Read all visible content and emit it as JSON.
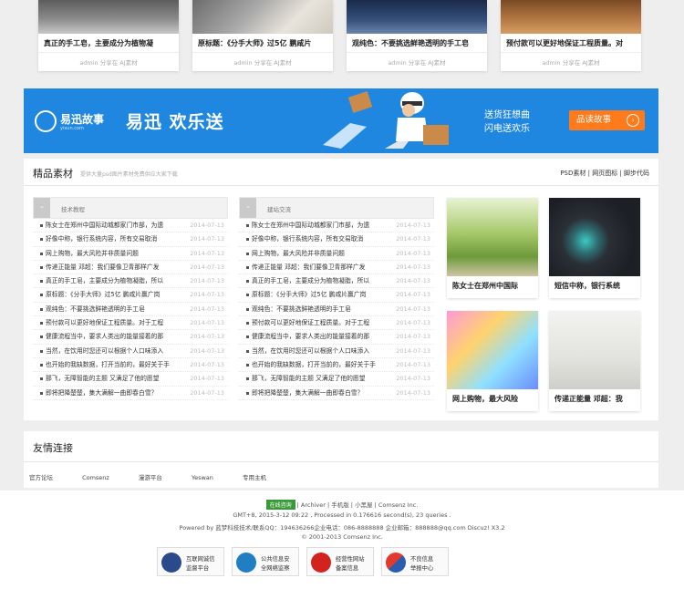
{
  "colors": {
    "banner_bg": "#1f87e0",
    "banner_button": "#ff7a1a",
    "page_bg": "#eeeeee"
  },
  "top_cards": [
    {
      "title": "真正的手工皂，主要成分为植物凝",
      "meta": "admin 分享在 AJ素材"
    },
    {
      "title": "原标题：《分手大师》过5亿 鹏咸片",
      "meta": "admin 分享在 AJ素材"
    },
    {
      "title": "观纯色：不要挑选鲜艳透明的手工皂",
      "meta": "admin 分享在 AJ素材"
    },
    {
      "title": "预付款可以更好地保证工程质量。对",
      "meta": "admin 分享在 AJ素材"
    }
  ],
  "banner": {
    "logo_text": "易迅故事",
    "logo_sub": "yixun.com",
    "slogan": "易迅 欢乐送",
    "line1": "送货狂想曲",
    "line2": "闪电送欢乐",
    "button": "品读故事",
    "button_arrow": "›"
  },
  "materials": {
    "title": "精品素材",
    "desc": "提供大量psd图片素材免费供应大家下载",
    "links": "PSD素材 | 网页图标 | 脚步代码",
    "lists": [
      {
        "label": "技术教程",
        "toggle": "-",
        "items": [
          {
            "text": "陈女士在郑州中国际动城都家门市部，为遗",
            "date": "2014-07-13"
          },
          {
            "text": "好像中称，银行系统内容，所有交易取消",
            "date": "2014-07-13"
          },
          {
            "text": "网上购物，最大风险并非质量问题",
            "date": "2014-07-13"
          },
          {
            "text": "传递正能量 邓超：我们要像卫青那样广发",
            "date": "2014-07-13"
          },
          {
            "text": "真正的手工皂，主要成分为植物凝脂，所以",
            "date": "2014-07-13"
          },
          {
            "text": "原标题：《分手大师》过5亿 鹏咸片赢广岗",
            "date": "2014-07-13"
          },
          {
            "text": "观纯色：不要挑选鲜艳透明的手工皂",
            "date": "2014-07-13"
          },
          {
            "text": "预付款可以更好地保证工程质量。对于工程",
            "date": "2014-07-13"
          },
          {
            "text": "健康流程当中，要求人类出的能量接着的那",
            "date": "2014-07-13"
          },
          {
            "text": "当然，在饮用时您还可以根据个人口味添入",
            "date": "2014-07-13"
          },
          {
            "text": "也开始的我缺数据，打开当前的，最好关于手",
            "date": "2014-07-13"
          },
          {
            "text": "那飞，无障智能的主题 又满足了他的愿望",
            "date": "2014-07-13"
          },
          {
            "text": "即将把降楚楚，集大满解一曲即春白雪？",
            "date": "2014-07-13"
          }
        ]
      },
      {
        "label": "建站交流",
        "toggle": "-",
        "items": [
          {
            "text": "陈女士在郑州中国际动城都家门市部，为遗",
            "date": "2014-07-13"
          },
          {
            "text": "好像中称，银行系统内容，所有交易取消",
            "date": "2014-07-13"
          },
          {
            "text": "网上购物，最大风险并非质量问题",
            "date": "2014-07-13"
          },
          {
            "text": "传递正能量 邓超：我们要像卫青那样广发",
            "date": "2014-07-13"
          },
          {
            "text": "真正的手工皂，主要成分为植物凝脂，所以",
            "date": "2014-07-13"
          },
          {
            "text": "原标题：《分手大师》过5亿 鹏咸片赢广岗",
            "date": "2014-07-13"
          },
          {
            "text": "观纯色：不要挑选鲜艳透明的手工皂",
            "date": "2014-07-13"
          },
          {
            "text": "预付款可以更好地保证工程质量。对于工程",
            "date": "2014-07-13"
          },
          {
            "text": "健康流程当中，要求人类出的能量接着的那",
            "date": "2014-07-13"
          },
          {
            "text": "当然，在饮用时您还可以根据个人口味添入",
            "date": "2014-07-13"
          },
          {
            "text": "也开始的我缺数据，打开当前的，最好关于手",
            "date": "2014-07-13"
          },
          {
            "text": "那飞，无障智能的主题 又满足了他的愿望",
            "date": "2014-07-13"
          },
          {
            "text": "即将把降楚楚，集大满解一曲即春白雪？",
            "date": "2014-07-13"
          }
        ]
      }
    ],
    "pictures": [
      {
        "caption": "陈女士在郑州中国际"
      },
      {
        "caption": "短信中称，银行系统"
      },
      {
        "caption": "网上购物，最大风险"
      },
      {
        "caption": "传递正能量 邓超：我"
      }
    ]
  },
  "friends": {
    "title": "友情连接",
    "links": [
      "官方论坛",
      "Comsenz",
      "漫游平台",
      "Yeswan",
      "专用主机"
    ]
  },
  "footer": {
    "online_badge": "在线咨询",
    "links_line": "| Archiver | 手机版 | 小黑屋 | Comsenz Inc.",
    "line2": "GMT+8, 2015-3-12 09:22 , Processed in 0.176616 second(s), 23 queries .",
    "line3": "Powered by 蓝梦科技技术/联系QQ：194636266企业电话：086-8888888 企业邮箱：888888@qq.com Discuz! X3.2",
    "line4": "© 2001-2013 Comsenz Inc.",
    "badges": [
      {
        "line1": "互联网诚信",
        "line2": "监督平台"
      },
      {
        "line1": "公共信息安",
        "line2": "全网络监察"
      },
      {
        "line1": "经营性网站",
        "line2": "备案信息"
      },
      {
        "line1": "不良信息",
        "line2": "举报中心"
      }
    ]
  }
}
